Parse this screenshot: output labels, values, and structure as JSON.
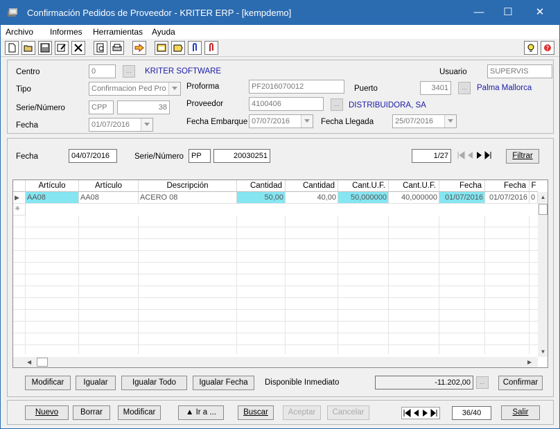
{
  "window": {
    "title": "Confirmación Pedidos de Proveedor - KRITER ERP - [kempdemo]"
  },
  "menu": [
    "Archivo",
    "Informes",
    "Herramientas",
    "Ayuda"
  ],
  "header": {
    "centro_label": "Centro",
    "centro_value": "0",
    "centro_name": "KRITER SOFTWARE",
    "usuario_label": "Usuario",
    "usuario_value": "SUPERVIS",
    "tipo_label": "Tipo",
    "tipo_value": "Confirmacion Ped Pro",
    "proforma_label": "Proforma",
    "proforma_value": "PF2016070012",
    "puerto_label": "Puerto",
    "puerto_value": "3401",
    "puerto_name": "Palma Mallorca",
    "serie_label": "Serie/Número",
    "serie_value": "CPP",
    "numero_value": "38",
    "proveedor_label": "Proveedor",
    "proveedor_value": "4100406",
    "proveedor_name": "DISTRIBUIDORA, SA",
    "fecha_label": "Fecha",
    "fecha_value": "01/07/2016",
    "embarque_label": "Fecha Embarque",
    "embarque_value": "07/07/2016",
    "llegada_label": "Fecha Llegada",
    "llegada_value": "25/07/2016"
  },
  "filter": {
    "fecha_label": "Fecha",
    "fecha_value": "04/07/2016",
    "serie_label": "Serie/Número",
    "serie_value": "PP",
    "numero_value": "20030251",
    "pager": "1/27",
    "filtrar": "Filtrar"
  },
  "grid": {
    "columns": [
      "Artículo",
      "Artículo",
      "Descripción",
      "Cantidad",
      "Cantidad",
      "Cant.U.F.",
      "Cant.U.F.",
      "Fecha",
      "Fecha",
      "F"
    ],
    "row": [
      "AA08",
      "AA08",
      "ACERO 08",
      "50,00",
      "40,00",
      "50,000000",
      "40,000000",
      "01/07/2016",
      "01/07/2016",
      "0"
    ]
  },
  "actions": {
    "modificar": "Modificar",
    "igualar": "Igualar",
    "igualar_todo": "Igualar Todo",
    "igualar_fecha": "Igualar Fecha",
    "disponible_label": "Disponible Inmediato",
    "disponible_value": "-11.202,00",
    "confirmar": "Confirmar"
  },
  "footer": {
    "nuevo": "Nuevo",
    "borrar": "Borrar",
    "modificar": "Modificar",
    "ir_a": "▲ Ir a ...",
    "buscar": "Buscar",
    "aceptar": "Aceptar",
    "cancelar": "Cancelar",
    "pager": "36/40",
    "salir": "Salir"
  },
  "colors": {
    "titlebar": "#2b6bb0",
    "highlight": "#85e6f2",
    "link": "#1a1aa6"
  }
}
